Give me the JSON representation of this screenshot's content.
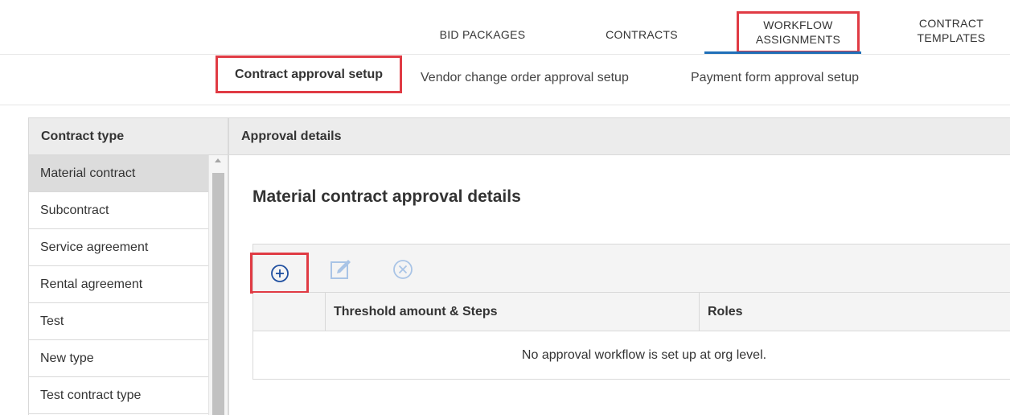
{
  "top_tabs": {
    "bid_packages": "BID PACKAGES",
    "contracts": "CONTRACTS",
    "workflow_line1": "WORKFLOW",
    "workflow_line2": "ASSIGNMENTS",
    "templates_line1": "CONTRACT",
    "templates_line2": "TEMPLATES",
    "active": "WORKFLOW ASSIGNMENTS"
  },
  "sub_tabs": {
    "contract_approval": "Contract approval setup",
    "vendor_change_order": "Vendor change order approval setup",
    "payment_form": "Payment form approval setup"
  },
  "left_panel": {
    "header": "Contract type",
    "items": [
      {
        "label": "Material contract",
        "selected": true
      },
      {
        "label": "Subcontract",
        "selected": false
      },
      {
        "label": "Service agreement",
        "selected": false
      },
      {
        "label": "Rental agreement",
        "selected": false
      },
      {
        "label": "Test",
        "selected": false
      },
      {
        "label": "New type",
        "selected": false
      },
      {
        "label": "Test contract type",
        "selected": false
      }
    ]
  },
  "right_panel": {
    "header": "Approval details",
    "title": "Material contract approval details",
    "toolbar": {
      "add_icon": "plus-circle-icon",
      "edit_icon": "edit-icon",
      "delete_icon": "x-circle-icon"
    },
    "table": {
      "columns": [
        "",
        "Threshold amount & Steps",
        "Roles"
      ],
      "empty_message": "No approval workflow is set up at org level."
    }
  },
  "colors": {
    "highlight": "#e03b44",
    "accent": "#1f6fb8",
    "header_bg": "#ececec"
  }
}
